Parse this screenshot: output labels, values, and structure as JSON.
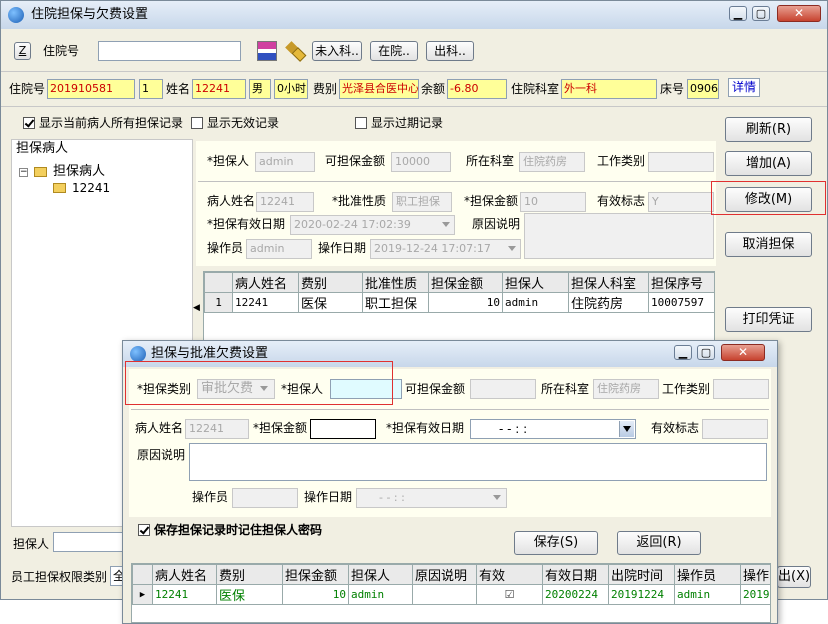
{
  "main_window": {
    "title": "住院担保与欠费设置",
    "toolbar": {
      "z_label": "Z",
      "inpatient_no_label": "住院号",
      "inpatient_no_value": "",
      "btn_not_admitted": "未入科..",
      "btn_in_hospital": "在院..",
      "btn_discharged": "出科.."
    },
    "patient_info": {
      "inpatient_no_label": "住院号",
      "inpatient_no": "201910581",
      "seq": "1",
      "name_label": "姓名",
      "name": "12241",
      "sex": "男",
      "hours": "0小时",
      "fee_type_label": "费别",
      "fee_type": "光泽县合医中心",
      "balance_label": "余额",
      "balance": "-6.80",
      "dept_label": "住院科室",
      "dept": "外一科",
      "bed_label": "床号",
      "bed": "0906",
      "detail_link": "详情"
    },
    "filters": {
      "show_all": "显示当前病人所有担保记录",
      "show_invalid": "显示无效记录",
      "show_expired": "显示过期记录"
    },
    "tree": {
      "header": "担保病人",
      "root": "担保病人",
      "child": "12241"
    },
    "bottom": {
      "guarantor_label": "担保人",
      "perm_label": "员工担保权限类别",
      "perm_value": "全"
    },
    "form": {
      "guarantor_label": "*担保人",
      "guarantor_value": "admin",
      "amount_avail_label": "可担保金额",
      "amount_avail_value": "10000",
      "dept_label": "所在科室",
      "dept_value": "住院药房",
      "work_type_label": "工作类别",
      "work_type_value": "",
      "patient_name_label": "病人姓名",
      "patient_name_value": "12241",
      "approve_type_label": "*批准性质",
      "approve_type_value": "职工担保",
      "amount_label": "*担保金额",
      "amount_value": "10",
      "valid_flag_label": "有效标志",
      "valid_flag_value": "Y",
      "valid_date_label": "*担保有效日期",
      "valid_date_value": "2020-02-24 17:02:39",
      "reason_label": "原因说明",
      "reason_value": "",
      "operator_label": "操作员",
      "operator_value": "admin",
      "op_date_label": "操作日期",
      "op_date_value": "2019-12-24 17:07:17"
    },
    "grid": {
      "headers": [
        "",
        "病人姓名",
        "费别",
        "批准性质",
        "担保金额",
        "担保人",
        "担保人科室",
        "担保序号"
      ],
      "rows": [
        [
          "1",
          "12241",
          "医保",
          "职工担保",
          "10",
          "admin",
          "住院药房",
          "10007597"
        ]
      ]
    },
    "buttons": {
      "refresh": "刷新(R)",
      "add": "增加(A)",
      "modify": "修改(M)",
      "cancel_guarantee": "取消担保",
      "print": "打印凭证",
      "exit_partial": "出(X)"
    }
  },
  "dialog": {
    "title": "担保与批准欠费设置",
    "guarantee_type_label": "*担保类别",
    "guarantee_type_value": "审批欠费",
    "guarantor_label": "*担保人",
    "guarantor_value": "",
    "amount_avail_label": "可担保金额",
    "amount_avail_value": "",
    "dept_label": "所在科室",
    "dept_value": "住院药房",
    "work_type_label": "工作类别",
    "work_type_value": "",
    "patient_name_label": "病人姓名",
    "patient_name_value": "12241",
    "amount_label": "*担保金额",
    "amount_value": "",
    "valid_date_label": "*担保有效日期",
    "valid_date_value": "-   -      :   :",
    "valid_flag_label": "有效标志",
    "valid_flag_value": "",
    "reason_label": "原因说明",
    "operator_label": "操作员",
    "op_date_label": "操作日期",
    "op_date_value": "-   -      :   :",
    "save_password_label": "保存担保记录时记住担保人密码",
    "save_button": "保存(S)",
    "back_button": "返回(R)",
    "grid": {
      "headers": [
        "",
        "病人姓名",
        "费别",
        "担保金额",
        "担保人",
        "原因说明",
        "有效",
        "有效日期",
        "出院时间",
        "操作员",
        "操作"
      ],
      "rows": [
        [
          "▶",
          "12241",
          "医保",
          "10",
          "admin",
          "",
          "☑",
          "20200224",
          "20191224",
          "admin",
          "2019"
        ]
      ]
    }
  },
  "colors": {
    "highlight_red": "#e03030",
    "form_bg": "#fffff0",
    "face": "#f1efe2"
  }
}
